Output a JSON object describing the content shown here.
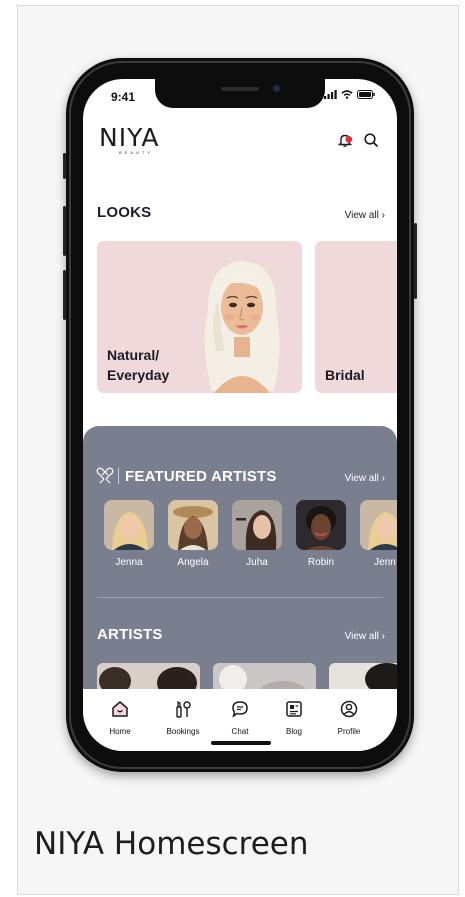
{
  "caption": "NIYA Homescreen",
  "status": {
    "time": "9:41"
  },
  "app": {
    "logo": "NIYA",
    "logo_sub": "BEAUTY"
  },
  "looks": {
    "title": "LOOKS",
    "view_all": "View all ›",
    "cards": [
      {
        "label_line1": "Natural/",
        "label_line2": "Everyday"
      },
      {
        "label_line1": "Bridal"
      }
    ]
  },
  "featured": {
    "title": "FEATURED ARTISTS",
    "view_all": "View all ›",
    "artists": [
      {
        "name": "Jenna"
      },
      {
        "name": "Angela"
      },
      {
        "name": "Juha"
      },
      {
        "name": "Robin"
      },
      {
        "name": "Jenn"
      }
    ]
  },
  "artists_section": {
    "title": "ARTISTS",
    "view_all": "View all ›"
  },
  "tabs": [
    {
      "label": "Home",
      "icon": "home-icon"
    },
    {
      "label": "Bookings",
      "icon": "makeup-icon"
    },
    {
      "label": "Chat",
      "icon": "chat-icon"
    },
    {
      "label": "Blog",
      "icon": "blog-icon"
    },
    {
      "label": "Profile",
      "icon": "profile-icon"
    }
  ],
  "colors": {
    "look_card": "#f0d9db",
    "featured_bg": "#7a7f8f",
    "notification_dot": "#e0303a",
    "home_tab_fill": "#f4d8dc"
  }
}
